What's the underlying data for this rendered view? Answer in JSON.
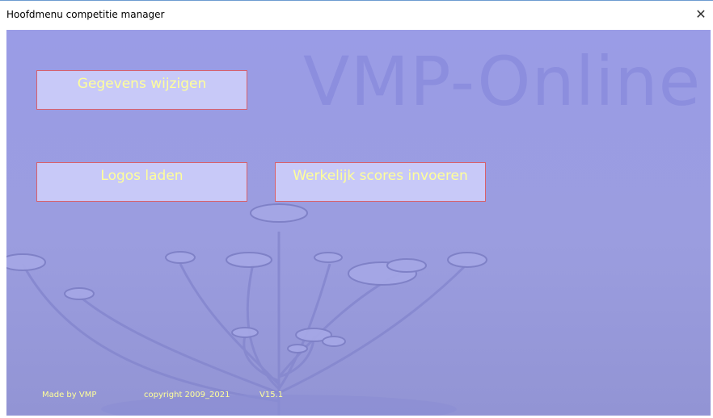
{
  "window": {
    "title": "Hoofdmenu competitie manager",
    "close_glyph": "✕"
  },
  "watermark": "VMP-Online",
  "buttons": {
    "gegevens": "Gegevens wijzigen",
    "logos": "Logos laden",
    "scores": "Werkelijk scores invoeren"
  },
  "footer": {
    "made_by": "Made by VMP",
    "copyright": "copyright 2009_2021",
    "version": "V15.1"
  },
  "colors": {
    "background": "#9a9ce6",
    "button_fill": "#c8c9f8",
    "button_border": "#d9606a",
    "button_text": "#ffff99"
  }
}
